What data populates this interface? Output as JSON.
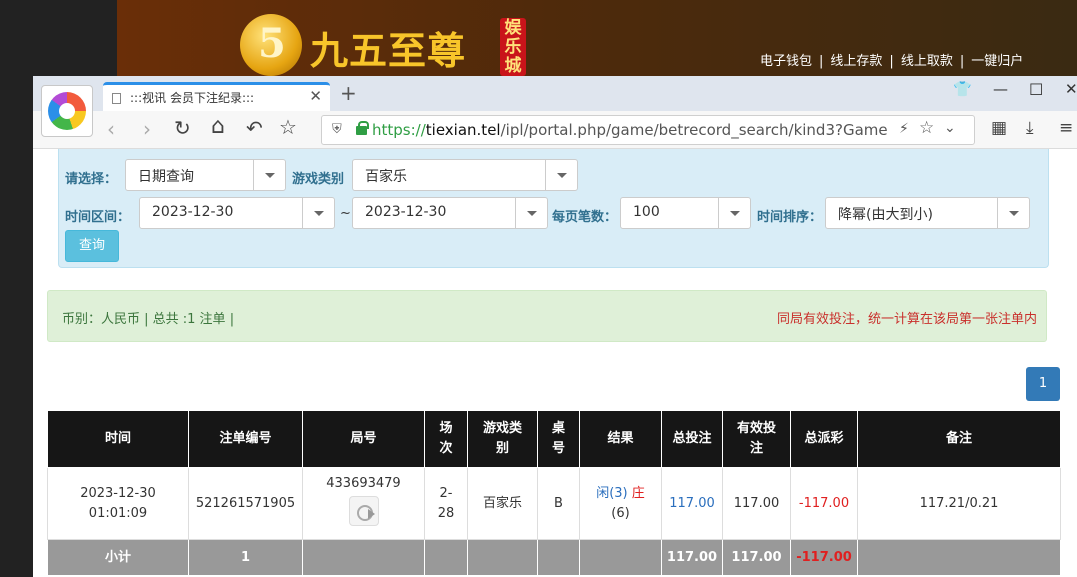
{
  "site": {
    "logo_digit": "5",
    "logo_text": "九五至尊",
    "logo_badge": "娱乐城",
    "nav": [
      "电子钱包",
      "线上存款",
      "线上取款",
      "一键归户"
    ]
  },
  "browser": {
    "tab_title": ":::视讯 会员下注纪录:::",
    "url_scheme": "https://",
    "url_host": "tiexian.tel",
    "url_path": "/ipl/portal.php/game/betrecord_search/kind3?Game"
  },
  "filters": {
    "select_label": "请选择：",
    "select_value": "日期查询",
    "game_type_label": "游戏类别",
    "game_type_value": "百家乐",
    "date_range_label": "时间区间：",
    "date_from": "2023-12-30",
    "date_separator": "~",
    "date_to": "2023-12-30",
    "page_size_label": "每页笔数：",
    "page_size_value": "100",
    "sort_label": "时间排序：",
    "sort_value": "降幂(由大到小)",
    "query_button": "查询"
  },
  "summary": {
    "left": "币别：人民币 | 总共 :1 注单 |",
    "note": "同局有效投注，统一计算在该局第一张注单内"
  },
  "pagination": {
    "current": "1"
  },
  "table": {
    "headers": [
      {
        "l1": "时间",
        "l2": ""
      },
      {
        "l1": "注单编号",
        "l2": ""
      },
      {
        "l1": "局号",
        "l2": ""
      },
      {
        "l1": "场",
        "l2": "次"
      },
      {
        "l1": "游戏类",
        "l2": "别"
      },
      {
        "l1": "桌",
        "l2": "号"
      },
      {
        "l1": "结果",
        "l2": ""
      },
      {
        "l1": "总投注",
        "l2": ""
      },
      {
        "l1": "有效投",
        "l2": "注"
      },
      {
        "l1": "总派彩",
        "l2": ""
      },
      {
        "l1": "备注",
        "l2": ""
      }
    ],
    "rows": [
      {
        "date": "2023-12-30",
        "time": "01:01:09",
        "bet_id": "521261571905",
        "round_id": "433693479",
        "session_l1": "2-",
        "session_l2": "28",
        "game": "百家乐",
        "table": "B",
        "result_player": "闲(3)",
        "result_banker": "庄",
        "result_banker_score": "(6)",
        "total_bet": "117.00",
        "valid_bet": "117.00",
        "payout": "-117.00",
        "remark": "117.21/0.21"
      }
    ],
    "subtotal": {
      "label": "小计",
      "count": "1",
      "total_bet": "117.00",
      "valid_bet": "117.00",
      "payout": "-117.00"
    }
  }
}
